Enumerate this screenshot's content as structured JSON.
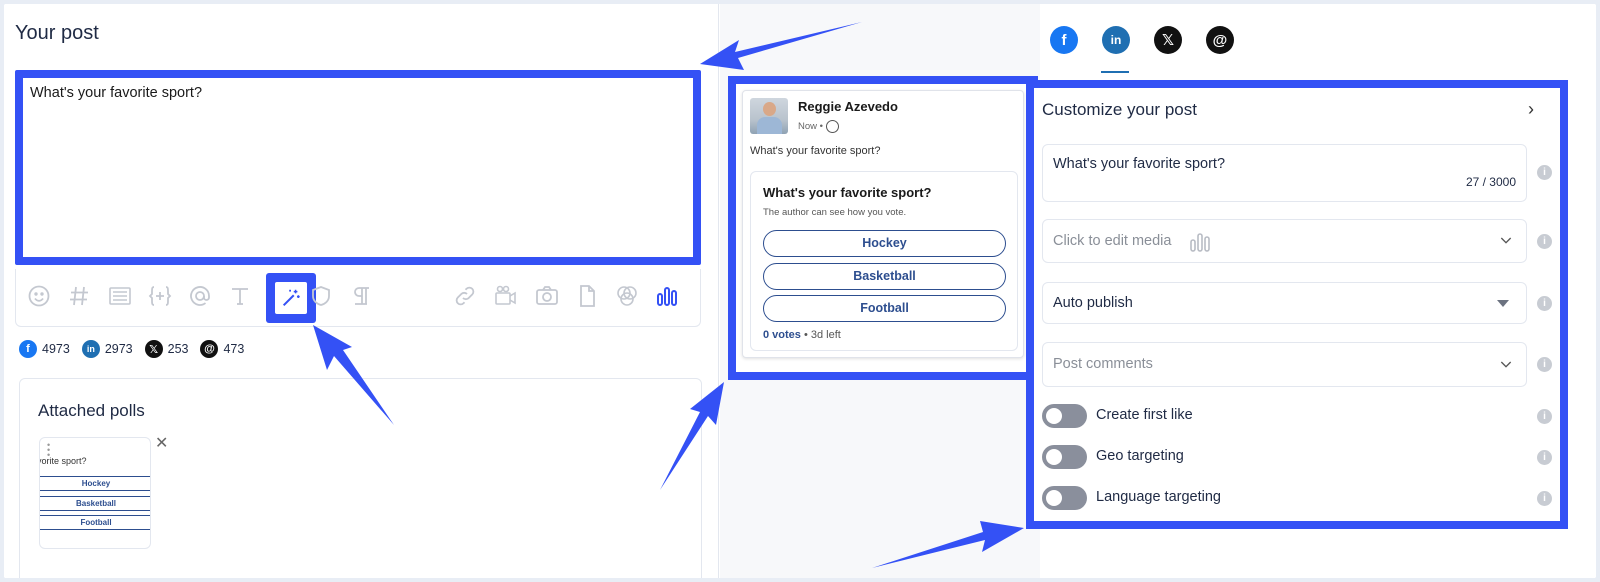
{
  "left": {
    "title": "Your post",
    "editor_text": "What's your favorite sport?",
    "toolbar_icons": [
      "emoji-icon",
      "hashtag-icon",
      "snippet-icon",
      "variable-icon",
      "mention-icon",
      "text-format-icon",
      "ai-wand-icon",
      "shield-icon",
      "paragraph-icon",
      "link-icon",
      "video-icon",
      "camera-icon",
      "file-icon",
      "canva-icon",
      "poll-icon"
    ],
    "counts": [
      {
        "network": "facebook",
        "value": "4973"
      },
      {
        "network": "linkedin",
        "value": "2973"
      },
      {
        "network": "x",
        "value": "253"
      },
      {
        "network": "threads",
        "value": "473"
      }
    ],
    "polls": {
      "title": "Attached polls",
      "thumb_question": "avorite sport?",
      "thumb_options": [
        "Hockey",
        "Basketball",
        "Football"
      ]
    }
  },
  "preview": {
    "name": "Reggie Azevedo",
    "meta": "Now •",
    "text": "What's your favorite sport?",
    "poll_question": "What's your favorite sport?",
    "poll_sub": "The author can see how you vote.",
    "options": [
      "Hockey",
      "Basketball",
      "Football"
    ],
    "votes": "0 votes",
    "time_left": " • 3d left"
  },
  "right": {
    "tabs": [
      {
        "name": "facebook",
        "glyph": "f",
        "color": "#1877f2"
      },
      {
        "name": "linkedin",
        "glyph": "in",
        "color": "#1f6fb2"
      },
      {
        "name": "x",
        "glyph": "𝕏",
        "color": "#111111"
      },
      {
        "name": "threads",
        "glyph": "@",
        "color": "#111111"
      }
    ],
    "customize": {
      "title": "Customize your post",
      "text_value": "What's your favorite sport?",
      "char_count": "27 / 3000",
      "media_placeholder": "Click to edit media",
      "publish_value": "Auto publish",
      "comments_placeholder": "Post comments",
      "toggles": [
        {
          "label": "Create first like",
          "on": false
        },
        {
          "label": "Geo targeting",
          "on": false
        },
        {
          "label": "Language targeting",
          "on": false
        }
      ]
    }
  },
  "colors": {
    "highlight": "#3451f5",
    "poll_blue": "#2d4e8f",
    "facebook": "#1877f2",
    "linkedin": "#1f6fb2"
  }
}
